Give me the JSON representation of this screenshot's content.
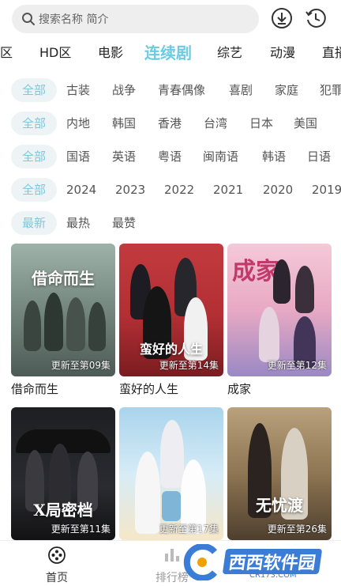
{
  "search": {
    "placeholder": "搜索名称 简介"
  },
  "icons": {
    "download": "download-icon",
    "history": "history-icon",
    "search": "search-icon"
  },
  "categories": [
    "区",
    "HD区",
    "电影",
    "连续剧",
    "综艺",
    "动漫",
    "直播"
  ],
  "active_category": "连续剧",
  "filters": {
    "genre": [
      "全部",
      "古装",
      "战争",
      "青春偶像",
      "喜剧",
      "家庭",
      "犯罪"
    ],
    "region": [
      "全部",
      "内地",
      "韩国",
      "香港",
      "台湾",
      "日本",
      "美国"
    ],
    "language": [
      "全部",
      "国语",
      "英语",
      "粤语",
      "闽南语",
      "韩语",
      "日语"
    ],
    "year": [
      "全部",
      "2024",
      "2023",
      "2022",
      "2021",
      "2020",
      "2019"
    ],
    "sort": [
      "最新",
      "最热",
      "最赞"
    ]
  },
  "shows": [
    {
      "title": "借命而生",
      "update": "更新至第09集",
      "poster_title": "借命而生"
    },
    {
      "title": "蛮好的人生",
      "update": "更新至第14集",
      "poster_title": "蛮好的人生"
    },
    {
      "title": "成家",
      "update": "更新至第12集",
      "poster_title": "成家"
    },
    {
      "title": "",
      "update": "更新至第11集",
      "poster_title": "X局密档"
    },
    {
      "title": "",
      "update": "更新至第17集",
      "poster_title": ""
    },
    {
      "title": "",
      "update": "更新至第26集",
      "poster_title": "无忧渡"
    }
  ],
  "bottom_nav": {
    "home": "首页",
    "rank": "排行榜"
  },
  "watermark": {
    "main": "西西软件园",
    "sub": "CR173.COM"
  },
  "colors": {
    "accent": "#6ccbe0",
    "chip_bg": "#eef4f6"
  }
}
